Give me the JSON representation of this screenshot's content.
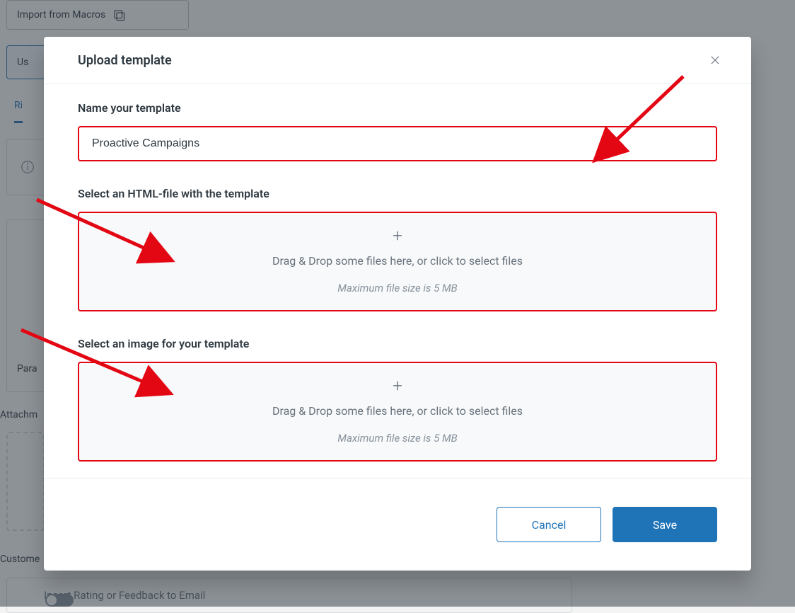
{
  "background": {
    "import_label": "Import from Macros",
    "use_label": "Us",
    "tab_label": "Ri",
    "para_label": "Para",
    "attachments_label": "Attachm",
    "customer_label": "Custome",
    "switch_label": "Insert Rating or Feedback to Email"
  },
  "modal": {
    "title": "Upload template",
    "name_section_label": "Name your template",
    "name_value": "Proactive Campaigns",
    "html_section_label": "Select an HTML-file with the template",
    "image_section_label": "Select an image for your template",
    "plus_label": "+",
    "drop_text": "Drag & Drop some files here, or click to select files",
    "max_text": "Maximum file size is 5 MB",
    "cancel_label": "Cancel",
    "save_label": "Save"
  },
  "annotation": {
    "arrow_color": "#e30613"
  }
}
